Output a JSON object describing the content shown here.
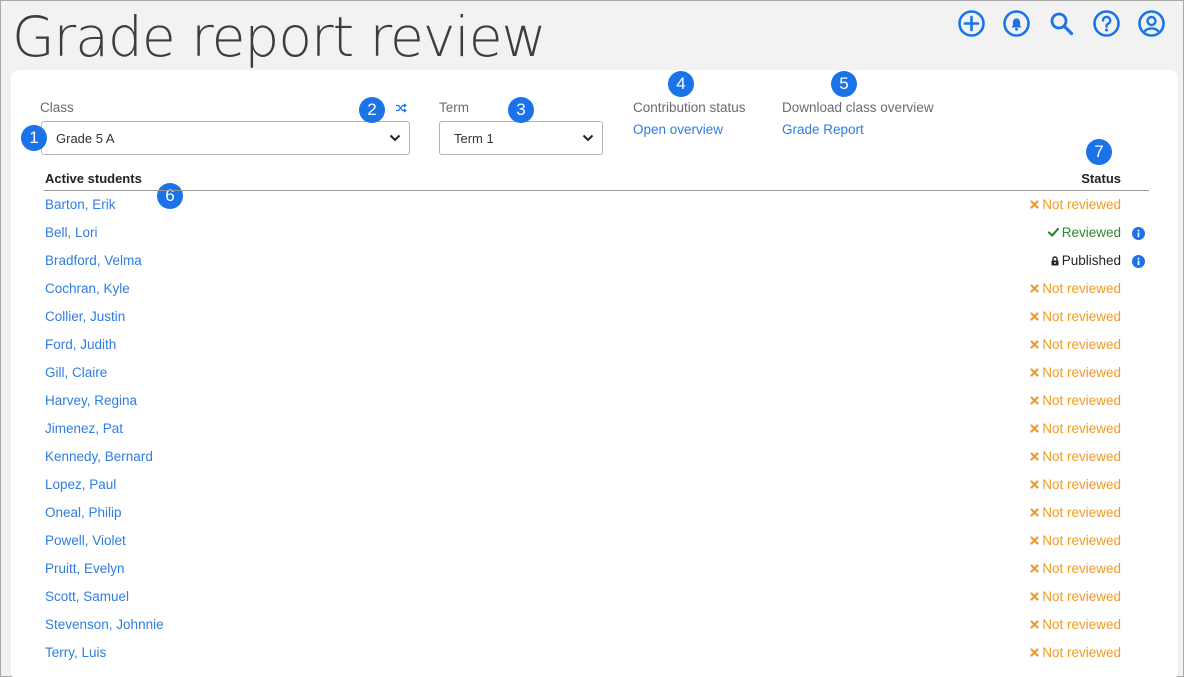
{
  "page": {
    "title": "Grade report review"
  },
  "header_icons": [
    "add-icon",
    "notification-bell-icon",
    "search-icon",
    "help-icon",
    "user-account-icon"
  ],
  "class_field": {
    "label": "Class",
    "value": "Grade 5 A"
  },
  "term_field": {
    "label": "Term",
    "value": "Term 1"
  },
  "contribution": {
    "label": "Contribution status",
    "link": "Open overview"
  },
  "download": {
    "label": "Download class overview",
    "link": "Grade Report"
  },
  "markers": [
    "1",
    "2",
    "3",
    "4",
    "5",
    "6",
    "7"
  ],
  "table": {
    "col_students": "Active students",
    "col_status": "Status",
    "rows": [
      {
        "name": "Barton, Erik",
        "status": "Not reviewed",
        "kind": "not"
      },
      {
        "name": "Bell, Lori",
        "status": "Reviewed",
        "kind": "reviewed"
      },
      {
        "name": "Bradford, Velma",
        "status": "Published",
        "kind": "published"
      },
      {
        "name": "Cochran, Kyle",
        "status": "Not reviewed",
        "kind": "not"
      },
      {
        "name": "Collier, Justin",
        "status": "Not reviewed",
        "kind": "not"
      },
      {
        "name": "Ford, Judith",
        "status": "Not reviewed",
        "kind": "not"
      },
      {
        "name": "Gill, Claire",
        "status": "Not reviewed",
        "kind": "not"
      },
      {
        "name": "Harvey, Regina",
        "status": "Not reviewed",
        "kind": "not"
      },
      {
        "name": "Jimenez, Pat",
        "status": "Not reviewed",
        "kind": "not"
      },
      {
        "name": "Kennedy, Bernard",
        "status": "Not reviewed",
        "kind": "not"
      },
      {
        "name": "Lopez, Paul",
        "status": "Not reviewed",
        "kind": "not"
      },
      {
        "name": "Oneal, Philip",
        "status": "Not reviewed",
        "kind": "not"
      },
      {
        "name": "Powell, Violet",
        "status": "Not reviewed",
        "kind": "not"
      },
      {
        "name": "Pruitt, Evelyn",
        "status": "Not reviewed",
        "kind": "not"
      },
      {
        "name": "Scott, Samuel",
        "status": "Not reviewed",
        "kind": "not"
      },
      {
        "name": "Stevenson, Johnnie",
        "status": "Not reviewed",
        "kind": "not"
      },
      {
        "name": "Terry, Luis",
        "status": "Not reviewed",
        "kind": "not"
      }
    ]
  },
  "colors": {
    "accent": "#1a73e8",
    "link": "#2f7de1",
    "not_reviewed": "#f29a1f",
    "reviewed": "#2f8a2f"
  }
}
